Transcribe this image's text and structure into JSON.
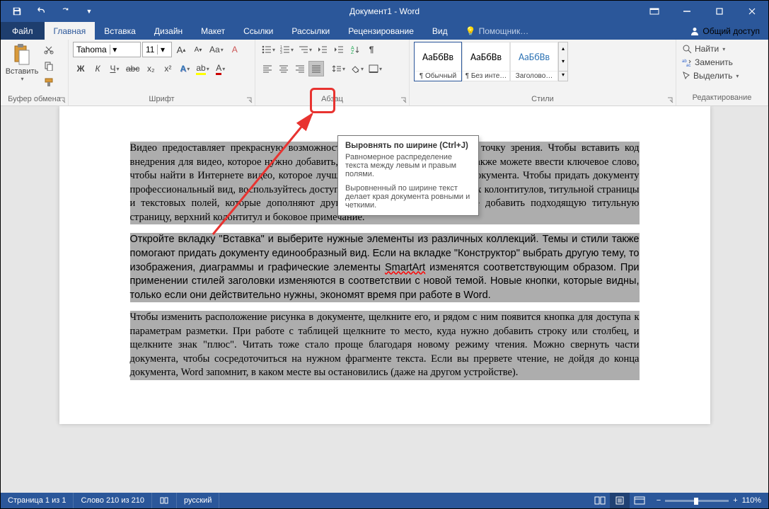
{
  "title": "Документ1 - Word",
  "tabs": {
    "file": "Файл",
    "home": "Главная",
    "insert": "Вставка",
    "design": "Дизайн",
    "layout": "Макет",
    "references": "Ссылки",
    "mailings": "Рассылки",
    "review": "Рецензирование",
    "view": "Вид"
  },
  "tellme": "Помощник…",
  "share": "Общий доступ",
  "clipboard": {
    "group": "Буфер обмена",
    "paste": "Вставить"
  },
  "font": {
    "group": "Шрифт",
    "name": "Tahoma",
    "size": "11",
    "bold": "Ж",
    "italic": "К",
    "underline": "Ч",
    "strike": "abc",
    "sub": "x₂",
    "sup": "x²",
    "grow": "A",
    "shrink": "A",
    "case": "Aa",
    "clear": "A"
  },
  "paragraph": {
    "group": "Абзац",
    "showmarks": "¶"
  },
  "styles": {
    "group": "Стили",
    "preview": "АаБбВв",
    "items": [
      {
        "name": "¶ Обычный",
        "color": "#000"
      },
      {
        "name": "¶ Без инте…",
        "color": "#000"
      },
      {
        "name": "Заголово…",
        "color": "#2e74b5"
      }
    ]
  },
  "editing": {
    "group": "Редактирование",
    "find": "Найти",
    "replace": "Заменить",
    "select": "Выделить"
  },
  "tooltip": {
    "title": "Выровнять по ширине (Ctrl+J)",
    "body1": "Равномерное распределение текста между левым и правым полями.",
    "body2": "Выровненный по ширине текст делает края документа ровными и четкими."
  },
  "document": {
    "p1": "Видео предоставляет прекрасную возможность наглядно представить свою точку зрения. Чтобы вставить код внедрения для видео, которое нужно добавить, нажмите \"Видео в сети\". Вы также можете ввести ключевое слово, чтобы найти в Интернете видео, которое лучше всего подходит для вашего документа. Чтобы придать документу профессиональный вид, воспользуйтесь доступными в Word верхних и нижних колонтитулов, титульной страницы и текстовых полей, которые дополняют друг друга. Например, вы можете добавить подходящую титульную страницу, верхний колонтитул и боковое примечание.",
    "p2a": "Откройте вкладку \"Вставка\" и выберите нужные элементы из различных коллекций. Темы и стили также помогают придать документу единообразный вид. Если на вкладке \"Конструктор\" выбрать другую тему, то изображения, диаграммы и графические элементы ",
    "p2wavy": "SmartArt",
    "p2b": " изменятся соответствующим образом. При применении стилей заголовки изменяются в соответствии с новой темой. Новые кнопки, которые видны, только если они действительно нужны, экономят время при работе в Word.",
    "p3": "Чтобы изменить расположение рисунка в документе, щелкните его, и рядом с ним появится кнопка для доступа к параметрам разметки. При работе с таблицей щелкните то место, куда нужно добавить строку или столбец, и щелкните знак \"плюс\". Читать тоже стало проще благодаря новому режиму чтения. Можно свернуть части документа, чтобы сосредоточиться на нужном фрагменте текста. Если вы прервете чтение, не дойдя до конца документа, Word запомнит, в каком месте вы остановились (даже на другом устройстве)."
  },
  "status": {
    "page": "Страница 1 из 1",
    "words": "Слово 210 из 210",
    "lang": "русский",
    "zoom": "110%"
  }
}
